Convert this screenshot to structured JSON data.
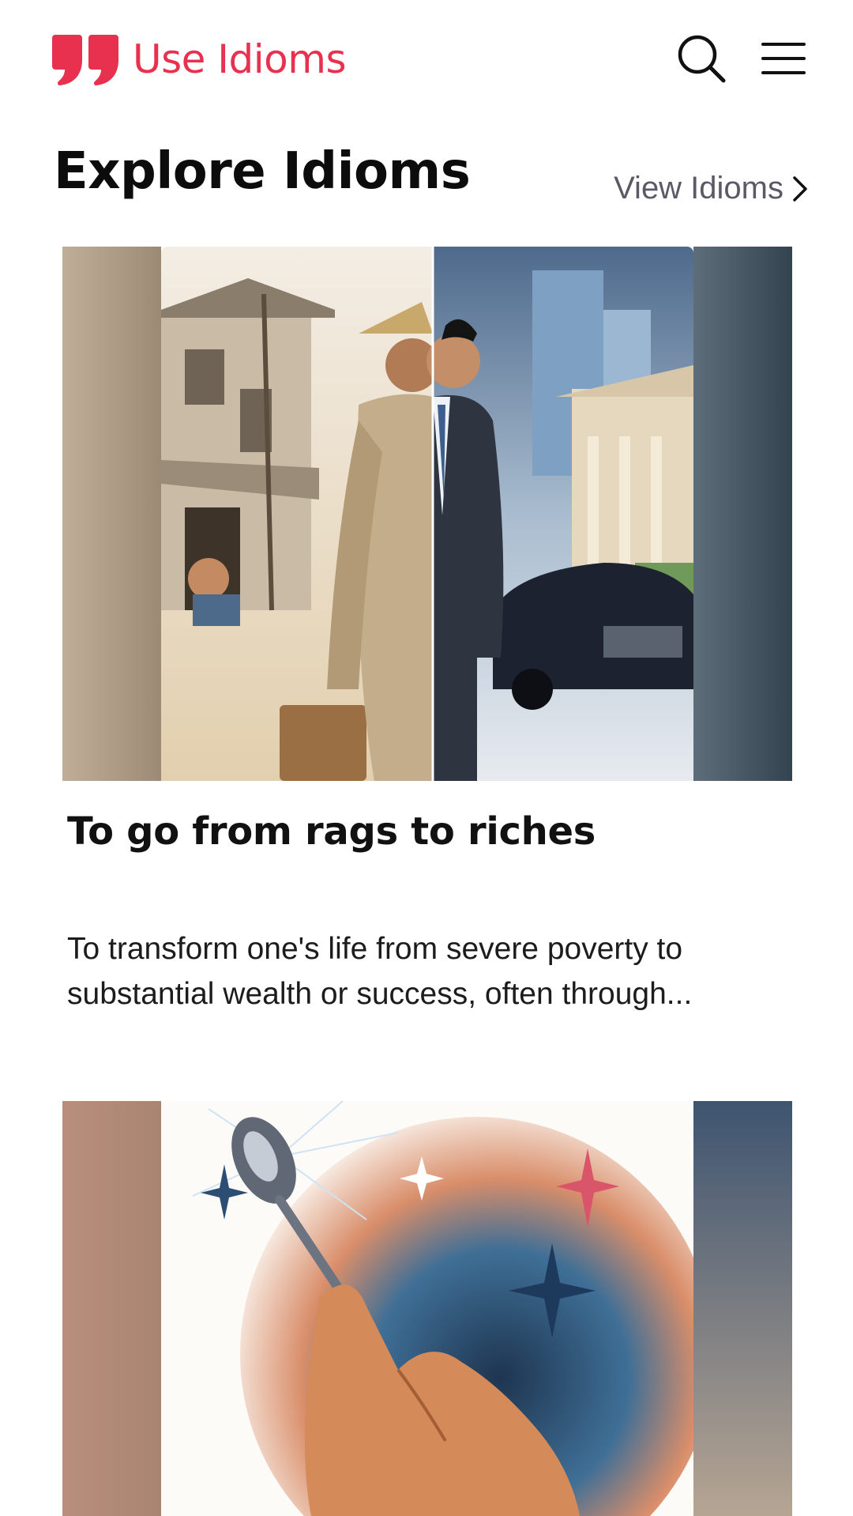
{
  "header": {
    "brand": "Use Idioms",
    "brand_color": "#e8304f",
    "icons": [
      "quote-logo-icon",
      "search-icon",
      "hamburger-menu-icon"
    ]
  },
  "section": {
    "title": "Explore Idioms",
    "view_link": "View Idioms",
    "view_link_icon": "chevron-right-icon"
  },
  "cards": [
    {
      "title": "To go from rags to riches",
      "description": "To transform one's life from severe poverty to substantial wealth or success, often through...",
      "image": "split-illustration-poor-man-to-rich-businessman"
    },
    {
      "image": "illustration-hand-holding-silver-spoon-with-stars"
    }
  ]
}
